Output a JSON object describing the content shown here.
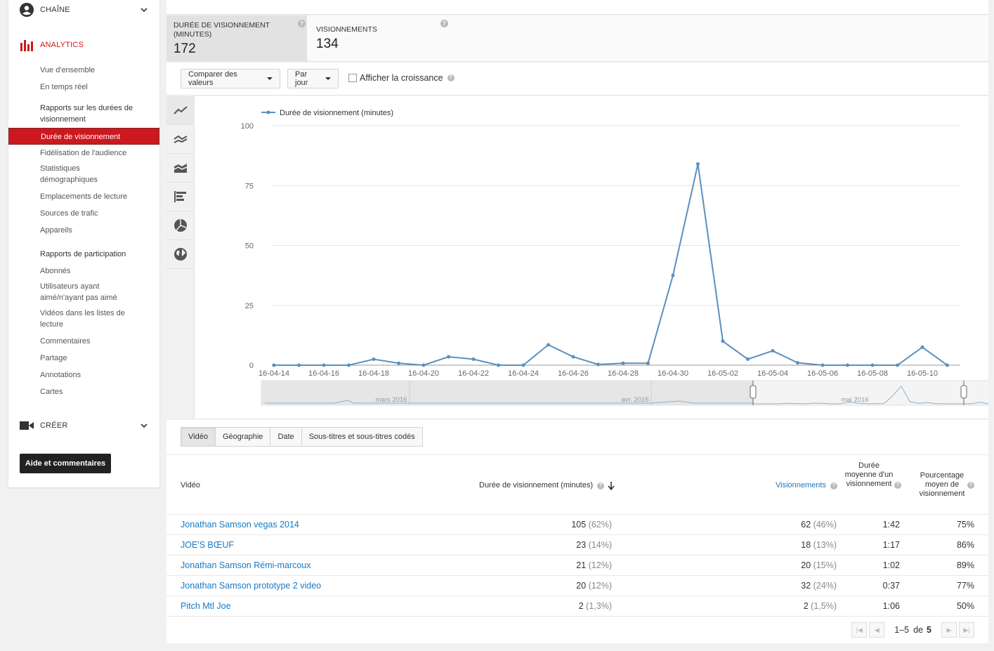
{
  "sidebar": {
    "channel_label": "CHAÎNE",
    "analytics_label": "ANALYTICS",
    "overview": "Vue d'ensemble",
    "realtime": "En temps réel",
    "watch_group": "Rapports sur les durées de visionnement",
    "watch_items": [
      "Durée de visionnement",
      "Fidélisation de l'audience",
      "Statistiques démographiques",
      "Emplacements de lecture",
      "Sources de trafic",
      "Appareils"
    ],
    "engage_group": "Rapports de participation",
    "engage_items": [
      "Abonnés",
      "Utilisateurs ayant aimé/n'ayant pas aimé",
      "Vidéos dans les listes de lecture",
      "Commentaires",
      "Partage",
      "Annotations",
      "Cartes"
    ],
    "create_label": "CRÉER",
    "help_button": "Aide et commentaires"
  },
  "metrics": [
    {
      "label": "DURÉE DE VISIONNEMENT (MINUTES)",
      "value": "172"
    },
    {
      "label": "VISIONNEMENTS",
      "value": "134"
    }
  ],
  "controls": {
    "compare": "Comparer des valeurs",
    "period": "Par jour",
    "growth": "Afficher la croissance"
  },
  "chart_data": {
    "type": "line",
    "legend": "Durée de visionnement (minutes)",
    "ylim": [
      0,
      100
    ],
    "yticks": [
      0,
      25,
      50,
      75,
      100
    ],
    "xtick_labels": [
      "16-04-14",
      "16-04-16",
      "16-04-18",
      "16-04-20",
      "16-04-22",
      "16-04-24",
      "16-04-26",
      "16-04-28",
      "16-04-30",
      "16-05-02",
      "16-05-04",
      "16-05-06",
      "16-05-08",
      "16-05-10"
    ],
    "series": [
      {
        "name": "Durée de visionnement (minutes)",
        "color": "#5b8fbf",
        "x": [
          "16-04-14",
          "16-04-15",
          "16-04-16",
          "16-04-17",
          "16-04-18",
          "16-04-19",
          "16-04-20",
          "16-04-21",
          "16-04-22",
          "16-04-23",
          "16-04-24",
          "16-04-25",
          "16-04-26",
          "16-04-27",
          "16-04-28",
          "16-04-29",
          "16-04-30",
          "16-05-01",
          "16-05-02",
          "16-05-03",
          "16-05-04",
          "16-05-05",
          "16-05-06",
          "16-05-07",
          "16-05-08",
          "16-05-09",
          "16-05-10",
          "16-05-11"
        ],
        "values": [
          0,
          0,
          0,
          0,
          2.5,
          0.8,
          0,
          3.5,
          2.5,
          0,
          0,
          8.5,
          3.5,
          0.3,
          0.8,
          0.8,
          37.5,
          84,
          10,
          2.5,
          6,
          1,
          0,
          0,
          0,
          0,
          7.5,
          0
        ]
      }
    ],
    "navigator_labels": [
      "mars 2016",
      "avr. 2016",
      "mai 2016"
    ]
  },
  "tabs": [
    "Vidéo",
    "Géographie",
    "Date",
    "Sous-titres et sous-titres codés"
  ],
  "table": {
    "headers": {
      "video": "Vidéo",
      "watch": "Durée de visionnement (minutes)",
      "views": "Visionnements",
      "avg": "Durée moyenne d'un visionnement",
      "pct": "Pourcentage moyen de visionnement"
    },
    "rows": [
      {
        "title": "Jonathan Samson vegas 2014",
        "watch": "105",
        "watch_pct": "(62%)",
        "views": "62",
        "views_pct": "(46%)",
        "avg": "1:42",
        "pct": "75%"
      },
      {
        "title": "JOE'S BŒUF",
        "watch": "23",
        "watch_pct": "(14%)",
        "views": "18",
        "views_pct": "(13%)",
        "avg": "1:17",
        "pct": "86%"
      },
      {
        "title": "Jonathan Samson Rémi-marcoux",
        "watch": "21",
        "watch_pct": "(12%)",
        "views": "20",
        "views_pct": "(15%)",
        "avg": "1:02",
        "pct": "89%"
      },
      {
        "title": "Jonathan Samson prototype 2 video",
        "watch": "20",
        "watch_pct": "(12%)",
        "views": "32",
        "views_pct": "(24%)",
        "avg": "0:37",
        "pct": "77%"
      },
      {
        "title": "Pitch Mtl Joe",
        "watch": "2",
        "watch_pct": "(1,3%)",
        "views": "2",
        "views_pct": "(1,5%)",
        "avg": "1:06",
        "pct": "50%"
      }
    ],
    "pager": {
      "range": "1–5",
      "of": "de",
      "total": "5"
    }
  },
  "colors": {
    "accent": "#cc181e",
    "link": "#167ac6",
    "series": "#5b8fbf"
  }
}
